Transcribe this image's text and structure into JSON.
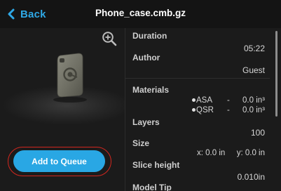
{
  "header": {
    "back_label": "Back",
    "title": "Phone_case.cmb.gz"
  },
  "preview": {
    "zoom_icon": "magnifier-plus-icon",
    "model_name": "phone-case-model"
  },
  "actions": {
    "add_to_queue_label": "Add to Queue"
  },
  "details": {
    "duration": {
      "label": "Duration",
      "value": "05:22"
    },
    "author": {
      "label": "Author",
      "value": "Guest"
    },
    "materials": {
      "label": "Materials",
      "items": [
        {
          "name": "ASA",
          "dash": "-",
          "value": "0.0 in³"
        },
        {
          "name": "QSR",
          "dash": "-",
          "value": "0.0 in³"
        }
      ]
    },
    "layers": {
      "label": "Layers",
      "value": "100"
    },
    "size": {
      "label": "Size",
      "x": "x: 0.0 in",
      "y": "y: 0.0 in"
    },
    "slice_height": {
      "label": "Slice height",
      "value": "0.010in"
    },
    "model_tip": {
      "label": "Model Tip"
    }
  },
  "colors": {
    "accent": "#29a7e4",
    "back_text": "#2fa8e6",
    "highlight_ring": "#d3271f",
    "background": "#1b1b1b",
    "header_bg": "#141414"
  }
}
